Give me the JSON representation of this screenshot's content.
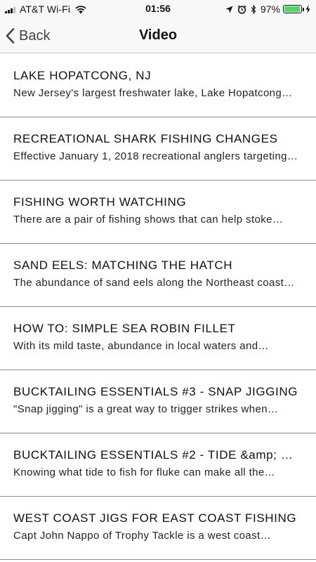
{
  "status_bar": {
    "carrier": "AT&T Wi-Fi",
    "time": "01:56",
    "battery_percent": "97%",
    "battery_level": 0.97,
    "icons": [
      "signal-icon",
      "wifi-icon",
      "location-icon",
      "alarm-icon",
      "bluetooth-icon",
      "battery-icon",
      "charging-icon"
    ]
  },
  "nav": {
    "back_label": "Back",
    "title": "Video"
  },
  "items": [
    {
      "title": "LAKE HOPATCONG, NJ",
      "description": "New Jersey's largest freshwater lake, Lake Hopatcong…"
    },
    {
      "title": "RECREATIONAL SHARK FISHING CHANGES",
      "description": "Effective January 1, 2018 recreational anglers targeting…"
    },
    {
      "title": "FISHING WORTH WATCHING",
      "description": "There are a pair of fishing shows that can help stoke…"
    },
    {
      "title": "SAND EELS: MATCHING THE HATCH",
      "description": "The abundance of sand eels along the Northeast coast…"
    },
    {
      "title": "HOW TO: SIMPLE SEA ROBIN FILLET",
      "description": "With its mild taste, abundance in local waters and…"
    },
    {
      "title": "BUCKTAILING ESSENTIALS #3 - SNAP JIGGING",
      "description": "\"Snap jigging\" is a great way to trigger strikes when…"
    },
    {
      "title": "BUCKTAILING ESSENTIALS #2 - TIDE &amp; …",
      "description": "Knowing what tide to fish for fluke can make all the…"
    },
    {
      "title": "WEST COAST JIGS FOR EAST COAST FISHING",
      "description": "Capt John Nappo of Trophy Tackle is a west coast…"
    }
  ]
}
